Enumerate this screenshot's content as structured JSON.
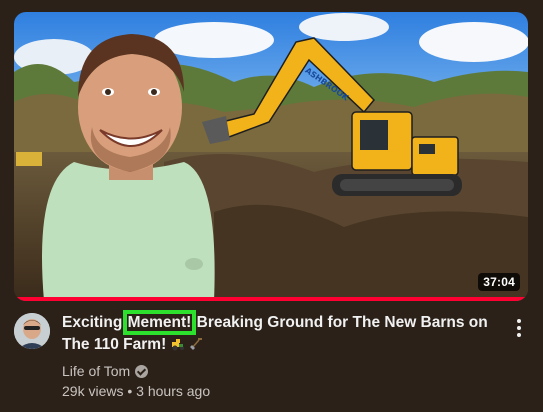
{
  "video": {
    "duration": "37:04",
    "watch_progress_fraction": 1.0,
    "title_before": "Exciting ",
    "title_highlight": "Mement!",
    "title_after": " Breaking Ground for The New Barns on The 110 Farm! ",
    "title_emojis": [
      "tractor",
      "shovel"
    ],
    "thumbnail_text": "ASHBROOK",
    "channel_name": "Life of Tom",
    "channel_verified": true,
    "views": "29k views",
    "separator": "•",
    "age": "3 hours ago"
  },
  "colors": {
    "background": "#2b2119",
    "progress": "#ff0033",
    "highlight_outline": "#2ee02e",
    "excavator": "#f2b21a"
  },
  "icons": {
    "more": "more-vert-icon",
    "verified": "verified-check-icon"
  }
}
